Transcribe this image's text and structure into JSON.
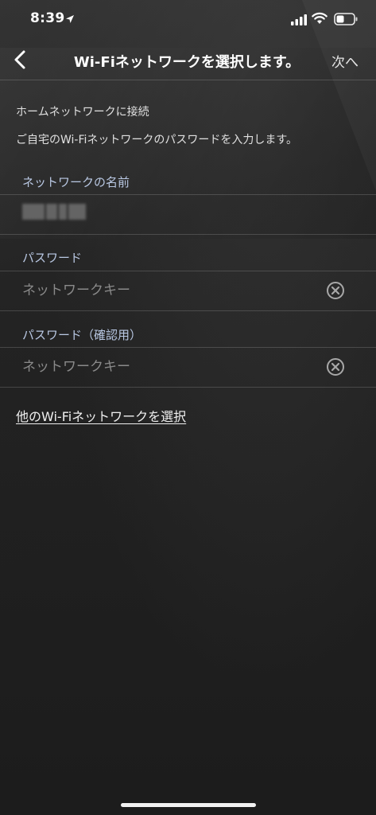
{
  "status_bar": {
    "time": "8:39",
    "icons": [
      "location-arrow-icon",
      "signal-icon",
      "wifi-icon",
      "battery-icon"
    ]
  },
  "nav": {
    "back_icon": "chevron-left-icon",
    "title": "Wi-Fiネットワークを選択します。",
    "next_label": "次へ"
  },
  "intro": {
    "title": "ホームネットワークに接続",
    "description": "ご自宅のWi-Fiネットワークのパスワードを入力します。"
  },
  "fields": {
    "network_name_label": "ネットワークの名前",
    "password_label": "パスワード",
    "password_placeholder": "ネットワークキー",
    "password_value": "",
    "confirm_label": "パスワード（確認用）",
    "confirm_placeholder": "ネットワークキー",
    "confirm_value": "",
    "clear_icon": "clear-circle-icon"
  },
  "other_network_link": "他のWi-Fiネットワークを選択",
  "colors": {
    "background": "#1f1f1f",
    "label_accent": "#b9c8e3",
    "text": "#e6e6e6",
    "placeholder": "#8a8a8a"
  }
}
